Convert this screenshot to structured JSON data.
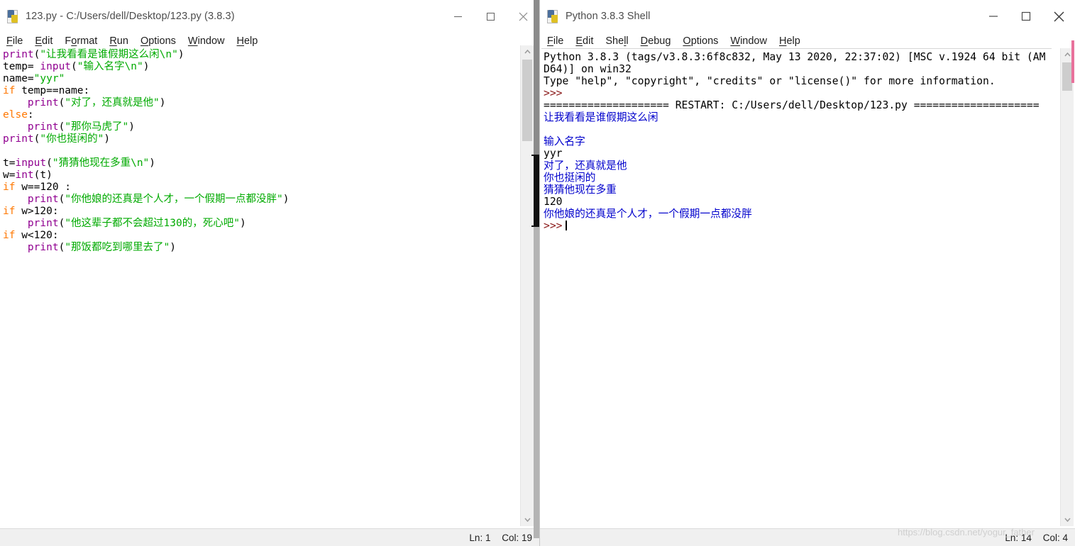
{
  "editor_window": {
    "title": "123.py - C:/Users/dell/Desktop/123.py (3.8.3)",
    "icon": "python-file-icon",
    "controls": {
      "minimize": "minimize-icon",
      "maximize": "maximize-icon",
      "close": "close-icon"
    },
    "menus": [
      "File",
      "Edit",
      "Format",
      "Run",
      "Options",
      "Window",
      "Help"
    ],
    "code_lines": [
      [
        {
          "t": "print",
          "c": "bi"
        },
        {
          "t": "(",
          "c": "def"
        },
        {
          "t": "\"让我看看是谁假期这么闲\\n\"",
          "c": "str"
        },
        {
          "t": ")",
          "c": "def"
        }
      ],
      [
        {
          "t": "temp= ",
          "c": "def"
        },
        {
          "t": "input",
          "c": "bi"
        },
        {
          "t": "(",
          "c": "def"
        },
        {
          "t": "\"输入名字\\n\"",
          "c": "str"
        },
        {
          "t": ")",
          "c": "def"
        }
      ],
      [
        {
          "t": "name=",
          "c": "def"
        },
        {
          "t": "\"yyr\"",
          "c": "str"
        }
      ],
      [
        {
          "t": "if",
          "c": "kw"
        },
        {
          "t": " temp==name:",
          "c": "def"
        }
      ],
      [
        {
          "t": "    ",
          "c": "def"
        },
        {
          "t": "print",
          "c": "bi"
        },
        {
          "t": "(",
          "c": "def"
        },
        {
          "t": "\"对了，还真就是他\"",
          "c": "str"
        },
        {
          "t": ")",
          "c": "def"
        }
      ],
      [
        {
          "t": "else",
          "c": "kw"
        },
        {
          "t": ":",
          "c": "def"
        }
      ],
      [
        {
          "t": "    ",
          "c": "def"
        },
        {
          "t": "print",
          "c": "bi"
        },
        {
          "t": "(",
          "c": "def"
        },
        {
          "t": "\"那你马虎了\"",
          "c": "str"
        },
        {
          "t": ")",
          "c": "def"
        }
      ],
      [
        {
          "t": "print",
          "c": "bi"
        },
        {
          "t": "(",
          "c": "def"
        },
        {
          "t": "\"你也挺闲的\"",
          "c": "str"
        },
        {
          "t": ")",
          "c": "def"
        }
      ],
      [],
      [
        {
          "t": "t=",
          "c": "def"
        },
        {
          "t": "input",
          "c": "bi"
        },
        {
          "t": "(",
          "c": "def"
        },
        {
          "t": "\"猜猜他现在多重\\n\"",
          "c": "str"
        },
        {
          "t": ")",
          "c": "def"
        }
      ],
      [
        {
          "t": "w=",
          "c": "def"
        },
        {
          "t": "int",
          "c": "bi"
        },
        {
          "t": "(t)",
          "c": "def"
        }
      ],
      [
        {
          "t": "if",
          "c": "kw"
        },
        {
          "t": " w==120 :",
          "c": "def"
        }
      ],
      [
        {
          "t": "    ",
          "c": "def"
        },
        {
          "t": "print",
          "c": "bi"
        },
        {
          "t": "(",
          "c": "def"
        },
        {
          "t": "\"你他娘的还真是个人才，一个假期一点都没胖\"",
          "c": "str"
        },
        {
          "t": ")",
          "c": "def"
        }
      ],
      [
        {
          "t": "if",
          "c": "kw"
        },
        {
          "t": " w>120:",
          "c": "def"
        }
      ],
      [
        {
          "t": "    ",
          "c": "def"
        },
        {
          "t": "print",
          "c": "bi"
        },
        {
          "t": "(",
          "c": "def"
        },
        {
          "t": "\"他这辈子都不会超过130的，死心吧\"",
          "c": "str"
        },
        {
          "t": ")",
          "c": "def"
        }
      ],
      [
        {
          "t": "if",
          "c": "kw"
        },
        {
          "t": " w<120:",
          "c": "def"
        }
      ],
      [
        {
          "t": "    ",
          "c": "def"
        },
        {
          "t": "print",
          "c": "bi"
        },
        {
          "t": "(",
          "c": "def"
        },
        {
          "t": "\"那饭都吃到哪里去了\"",
          "c": "str"
        },
        {
          "t": ")",
          "c": "def"
        }
      ]
    ],
    "status": {
      "line_label": "Ln: 1",
      "col_label": "Col: 19"
    }
  },
  "shell_window": {
    "title": "Python 3.8.3 Shell",
    "icon": "python-shell-icon",
    "controls": {
      "minimize": "minimize-icon",
      "maximize": "maximize-icon",
      "close": "close-icon"
    },
    "menus": [
      "File",
      "Edit",
      "Shell",
      "Debug",
      "Options",
      "Window",
      "Help"
    ],
    "output_lines": [
      {
        "text": "Python 3.8.3 (tags/v3.8.3:6f8c832, May 13 2020, 22:37:02) [MSC v.1924 64 bit (AM",
        "cls": "def"
      },
      {
        "text": "D64)] on win32",
        "cls": "def"
      },
      {
        "text": "Type \"help\", \"copyright\", \"credits\" or \"license()\" for more information.",
        "cls": "def"
      },
      {
        "text": ">>>",
        "cls": "prompt"
      },
      {
        "text": "==================== RESTART: C:/Users/dell/Desktop/123.py ====================",
        "cls": "restart"
      },
      {
        "text": "让我看看是谁假期这么闲",
        "cls": "out"
      },
      {
        "text": "",
        "cls": "out"
      },
      {
        "text": "输入名字",
        "cls": "out"
      },
      {
        "text": "yyr",
        "cls": "def"
      },
      {
        "text": "对了，还真就是他",
        "cls": "out"
      },
      {
        "text": "你也挺闲的",
        "cls": "out"
      },
      {
        "text": "猜猜他现在多重",
        "cls": "out"
      },
      {
        "text": "120",
        "cls": "def"
      },
      {
        "text": "你他娘的还真是个人才，一个假期一点都没胖",
        "cls": "out"
      },
      {
        "text": ">>>",
        "cls": "prompt",
        "caret": true
      }
    ],
    "status": {
      "line_label": "Ln: 14",
      "col_label": "Col: 4"
    }
  },
  "watermark": {
    "text": "https://blog.csdn.net/yogur_father"
  },
  "colors": {
    "keyword": "#ff7700",
    "builtin": "#900090",
    "string": "#00aa00",
    "shell_output": "#0000cc",
    "shell_prompt": "#8b1a1a",
    "window_bg": "#ffffff",
    "chrome_bg": "#f0f0f0"
  }
}
